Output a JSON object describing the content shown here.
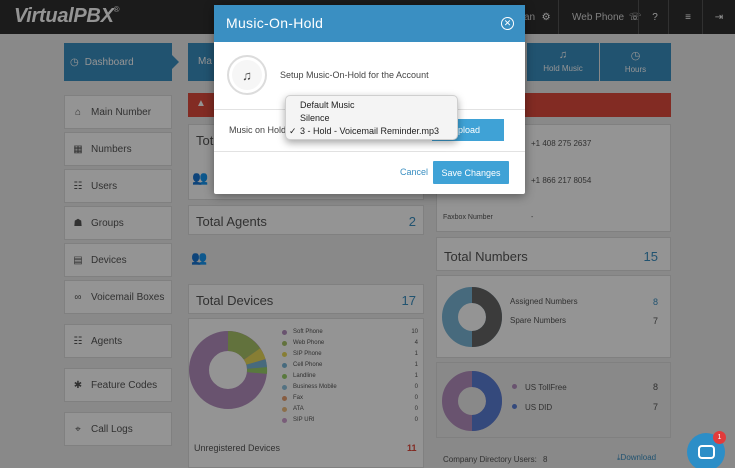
{
  "app": {
    "logo": "VirtualPBX",
    "logo_mark": "®"
  },
  "topbar": {
    "user_partial": "an",
    "web_phone": "Web Phone"
  },
  "sidebar": {
    "dashboard": "Dashboard",
    "items": [
      {
        "label": "Main Number",
        "icon": "home-icon"
      },
      {
        "label": "Numbers",
        "icon": "grid-icon"
      },
      {
        "label": "Users",
        "icon": "users-icon"
      },
      {
        "label": "Groups",
        "icon": "groups-icon"
      },
      {
        "label": "Devices",
        "icon": "devices-icon"
      },
      {
        "label": "Voicemail Boxes",
        "icon": "voicemail-icon"
      },
      {
        "label": "Agents",
        "icon": "agents-icon"
      },
      {
        "label": "Feature Codes",
        "icon": "asterisk-icon"
      },
      {
        "label": "Call Logs",
        "icon": "call-logs-icon"
      }
    ]
  },
  "tabs": {
    "main_partial": "Ma",
    "hold_music": "Hold Music",
    "hours": "Hours"
  },
  "panels": {
    "tot_partial": "Tot",
    "total_agents": {
      "label": "Total Agents",
      "value": "2"
    },
    "total_devices": {
      "label": "Total Devices",
      "value": "17"
    },
    "device_legend": [
      {
        "label": "Soft Phone",
        "value": "10",
        "color": "#b58fbf"
      },
      {
        "label": "Web Phone",
        "value": "4",
        "color": "#a9c46a"
      },
      {
        "label": "SIP Phone",
        "value": "1",
        "color": "#e8d95a"
      },
      {
        "label": "Cell Phone",
        "value": "1",
        "color": "#7ab7d8"
      },
      {
        "label": "Landline",
        "value": "1",
        "color": "#9ad06a"
      },
      {
        "label": "Business Mobile",
        "value": "0",
        "color": "#8fc4e0"
      },
      {
        "label": "Fax",
        "value": "0",
        "color": "#e8a070"
      },
      {
        "label": "ATA",
        "value": "0",
        "color": "#f0c080"
      },
      {
        "label": "SIP URI",
        "value": "0",
        "color": "#d0a0d0"
      }
    ],
    "unregistered": {
      "label": "Unregistered Devices",
      "value": "11"
    },
    "phone1": "+1 408 275 2637",
    "phone2": "+1 866 217 8054",
    "faxbox": {
      "label": "Faxbox Number",
      "value": "-"
    },
    "total_numbers": {
      "label": "Total Numbers",
      "value": "15"
    },
    "assigned": {
      "label": "Assigned Numbers",
      "value": "8"
    },
    "spare": {
      "label": "Spare Numbers",
      "value": "7"
    },
    "us_tollfree": {
      "label": "US TollFree",
      "value": "8"
    },
    "us_did": {
      "label": "US DID",
      "value": "7"
    },
    "company_dir": {
      "label": "Company Directory Users:",
      "value": "8"
    },
    "download": "Download"
  },
  "modal": {
    "title": "Music-On-Hold",
    "setup_text": "Setup Music-On-Hold for the Account",
    "field_label": "Music on Hold:",
    "upload": "Upload",
    "upload_partial": "pload",
    "cancel": "Cancel",
    "save": "Save Changes"
  },
  "dropdown": {
    "options": [
      "Default Music",
      "Silence",
      "3 - Hold - Voicemail Reminder.mp3"
    ],
    "selected": "3 - Hold - Voicemail Reminder.mp3",
    "check": "✓"
  },
  "chat": {
    "badge": "1"
  },
  "colors": {
    "accent": "#3a8fc2",
    "alert": "#e14b3d",
    "button": "#3fa2d6"
  }
}
